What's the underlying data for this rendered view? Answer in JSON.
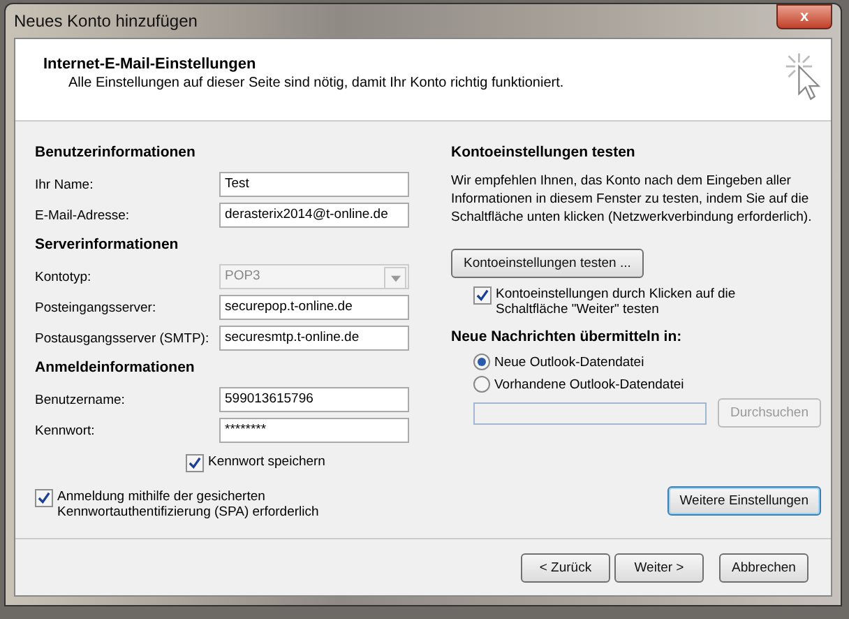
{
  "window": {
    "title": "Neues Konto hinzufügen",
    "close": "x"
  },
  "header": {
    "title": "Internet-E-Mail-Einstellungen",
    "subtitle": "Alle Einstellungen auf dieser Seite sind nötig, damit Ihr Konto richtig funktioniert."
  },
  "left_sections": [
    {
      "heading": "Benutzerinformationen",
      "fields": [
        {
          "label": "Ihr Name:",
          "value": "Test",
          "kind": "text",
          "disabled": false
        },
        {
          "label": "E-Mail-Adresse:",
          "value": "derasterix2014@t-online.de",
          "kind": "text",
          "disabled": false
        }
      ]
    },
    {
      "heading": "Serverinformationen",
      "fields": [
        {
          "label": "Kontotyp:",
          "value": "POP3",
          "kind": "select",
          "disabled": true
        },
        {
          "label": "Posteingangsserver:",
          "value": "securepop.t-online.de",
          "kind": "text",
          "disabled": false
        },
        {
          "label": "Postausgangsserver (SMTP):",
          "value": "securesmtp.t-online.de",
          "kind": "text",
          "disabled": false
        }
      ]
    },
    {
      "heading": "Anmeldeinformationen",
      "fields": [
        {
          "label": "Benutzername:",
          "value": "599013615796",
          "kind": "text",
          "disabled": false
        },
        {
          "label": "Kennwort:",
          "value": "********",
          "kind": "text",
          "disabled": false
        }
      ]
    }
  ],
  "save_password": {
    "label": "Kennwort speichern",
    "checked": true
  },
  "spa": {
    "label": "Anmeldung mithilfe der gesicherten Kennwortauthentifizierung (SPA) erforderlich",
    "checked": true
  },
  "test": {
    "heading": "Kontoeinstellungen testen",
    "description": "Wir empfehlen Ihnen, das Konto nach dem Eingeben aller Informationen in diesem Fenster zu testen, indem Sie auf die Schaltfläche unten klicken (Netzwerkverbindung erforderlich).",
    "button": "Kontoeinstellungen testen ...",
    "auto_test": {
      "label": "Kontoeinstellungen durch Klicken auf die Schaltfläche \"Weiter\" testen",
      "checked": true
    }
  },
  "deliver": {
    "heading": "Neue Nachrichten übermitteln in:",
    "options": [
      {
        "label": "Neue Outlook-Datendatei",
        "selected": true
      },
      {
        "label": "Vorhandene Outlook-Datendatei",
        "selected": false
      }
    ],
    "file_field": {
      "disabled": true
    },
    "browse": {
      "label": "Durchsuchen",
      "disabled": true
    }
  },
  "more_button": "Weitere Einstellungen",
  "buttons": [
    "< Zurück",
    "Weiter >",
    "Abbrechen"
  ]
}
